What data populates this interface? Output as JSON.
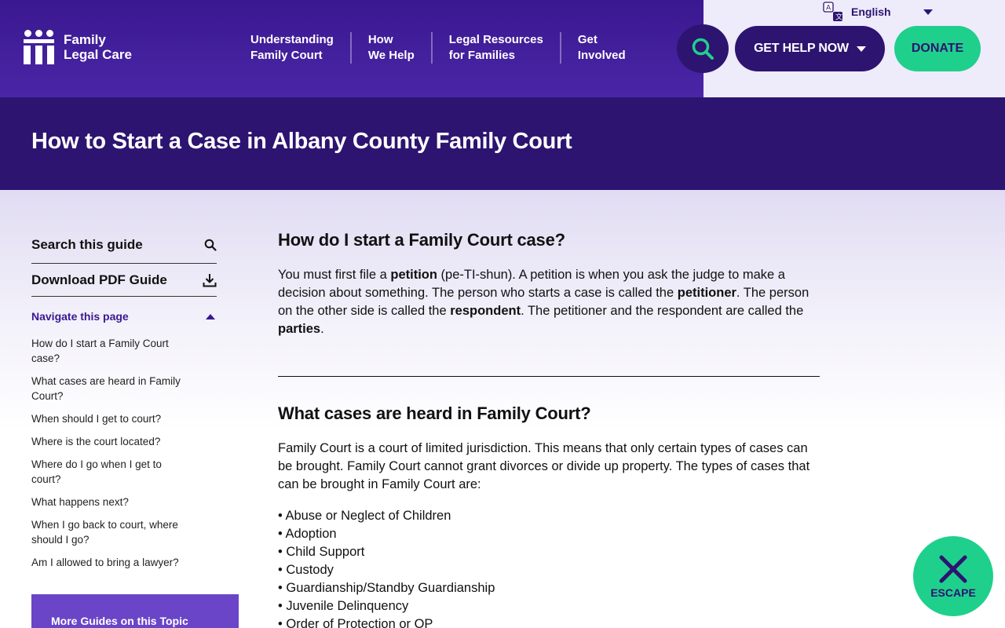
{
  "header": {
    "logo_line1": "Family",
    "logo_line2": "Legal Care",
    "nav": [
      {
        "line1": "Understanding",
        "line2": "Family Court"
      },
      {
        "line1": "How",
        "line2": "We Help"
      },
      {
        "line1": "Legal Resources",
        "line2": "for Families"
      },
      {
        "line1": "Get",
        "line2": "Involved"
      }
    ],
    "get_help_label": "GET HELP NOW",
    "donate_label": "DONATE",
    "language": "English"
  },
  "page_title": "How to Start a Case in Albany County Family Court",
  "sidebar": {
    "search_label": "Search this guide",
    "download_label": "Download PDF Guide",
    "navigate_label": "Navigate this page",
    "toc": [
      "How do I start a Family Court case?",
      "What cases are heard in Family Court?",
      "When should I get to court?",
      "Where is the court located?",
      "Where do I go when I get to court?",
      "What happens next?",
      "When I go back to court, where should I go?",
      "Am I allowed to bring a lawyer?"
    ],
    "more_guides_label": "More Guides on this Topic"
  },
  "main": {
    "section1": {
      "heading": "How do I start a Family Court case?",
      "p_parts": [
        "You must first file a ",
        "petition",
        " (pe-TI-shun). A petition is when you ask the judge to make a decision about something. The person who starts a case is called the ",
        "petitioner",
        ". The person on the other side is called the ",
        "respondent",
        ". The petitioner and the respondent are called the ",
        "parties",
        "."
      ]
    },
    "section2": {
      "heading": "What cases are heard in Family Court?",
      "paragraph": "Family Court is a court of limited jurisdiction. This means that only certain types of cases can be brought. Family Court cannot grant divorces or divide up property. The types of cases that can be brought in Family Court are:",
      "bullets": [
        "• Abuse or Neglect of Children",
        "• Adoption",
        "• Child Support",
        "• Custody",
        "• Guardianship/Standby Guardianship",
        "• Juvenile Delinquency",
        "• Order of Protection or OP"
      ]
    }
  },
  "escape_label": "ESCAPE",
  "colors": {
    "brand_purple": "#2d1470",
    "header_purple": "#3a1890",
    "accent_green": "#1fd08d",
    "guide_purple": "#6b45c8"
  }
}
